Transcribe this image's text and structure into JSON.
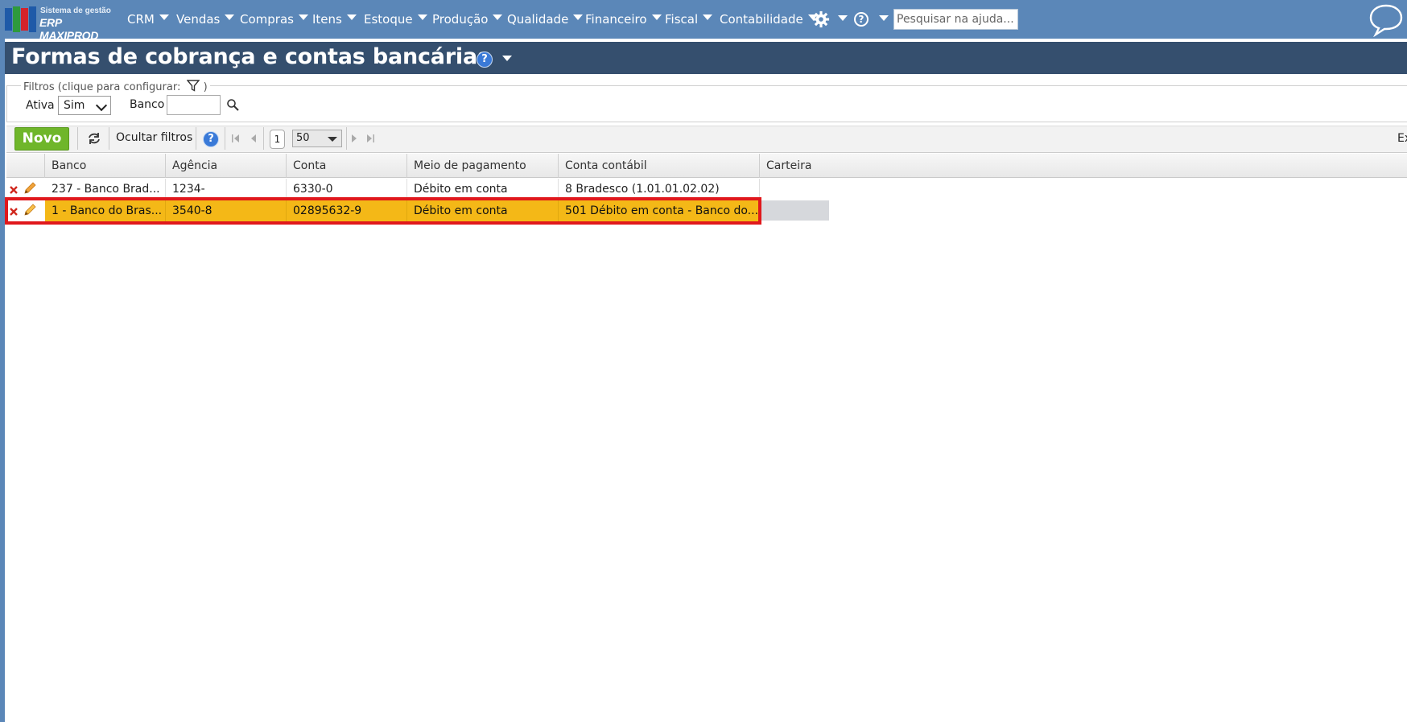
{
  "app": {
    "logo_line1": "Sistema de gestão",
    "logo_line2": "ERP MAXIPROD"
  },
  "nav": {
    "items": [
      {
        "label": "CRM"
      },
      {
        "label": "Vendas"
      },
      {
        "label": "Compras"
      },
      {
        "label": "Itens"
      },
      {
        "label": "Estoque"
      },
      {
        "label": "Produção"
      },
      {
        "label": "Qualidade"
      },
      {
        "label": "Financeiro"
      },
      {
        "label": "Fiscal"
      },
      {
        "label": "Contabilidade"
      }
    ],
    "settings_icon": "gear-icon",
    "help_icon": "question-circle-icon",
    "help_glyph": "?",
    "search_placeholder": "Pesquisar na ajuda...",
    "chat_icon": "speech-bubble-icon"
  },
  "page": {
    "title": "Formas de cobrança e contas bancárias",
    "help_glyph": "?"
  },
  "filters": {
    "legend": "Filtros (clique para configurar:",
    "legend_end": ")",
    "ativa_label": "Ativa",
    "ativa_value": "Sim",
    "banco_label": "Banco",
    "banco_value": ""
  },
  "toolbar": {
    "novo_label": "Novo",
    "hide_filters_label": "Ocultar filtros",
    "help_glyph": "?",
    "current_page": "1",
    "per_page": "50",
    "cut_label": "Ex"
  },
  "grid": {
    "columns": [
      "Banco",
      "Agência",
      "Conta",
      "Meio de pagamento",
      "Conta contábil",
      "Carteira"
    ],
    "rows": [
      {
        "banco": "237 - Banco Brad...",
        "agencia": "1234-",
        "conta": "6330-0",
        "meio": "Débito em conta",
        "conta_contabil": "8 Bradesco (1.01.01.02.02)",
        "carteira": "",
        "selected": false
      },
      {
        "banco": "1 - Banco do Bras...",
        "agencia": "3540-8",
        "conta": "02895632-9",
        "meio": "Débito em conta",
        "conta_contabil": "501 Débito em conta - Banco do...",
        "carteira": "",
        "selected": true
      }
    ]
  },
  "colors": {
    "topnav": "#5b87b8",
    "titlebar": "#354f6e",
    "novo_button": "#6fb62a",
    "selected_row": "#f4b817",
    "highlight_border": "#e0181c"
  }
}
